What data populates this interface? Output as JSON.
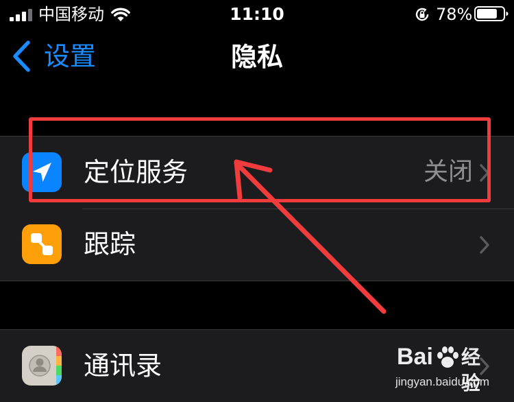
{
  "status_bar": {
    "carrier": "中国移动",
    "time": "11:10",
    "battery_percent": "78%",
    "battery_level": 0.78
  },
  "nav": {
    "back_label": "设置",
    "title": "隐私"
  },
  "groups": [
    {
      "items": [
        {
          "label": "定位服务",
          "value": "关闭",
          "icon": "location-arrow-icon",
          "icon_color": "#0a84ff"
        },
        {
          "label": "跟踪",
          "value": "",
          "icon": "tracking-icon",
          "icon_color": "#ff9f0a"
        }
      ]
    },
    {
      "items": [
        {
          "label": "通讯录",
          "value": "",
          "icon": "contacts-icon",
          "icon_color": "#c7c2b8"
        }
      ]
    }
  ],
  "colors": {
    "accent": "#1a8cff",
    "annotation": "#f03c3c",
    "background": "#000000",
    "cell_background": "#1c1c1e"
  },
  "watermark": {
    "brand": "Bai",
    "brand_suffix": "经验",
    "url": "jingyan.baidu.com"
  }
}
